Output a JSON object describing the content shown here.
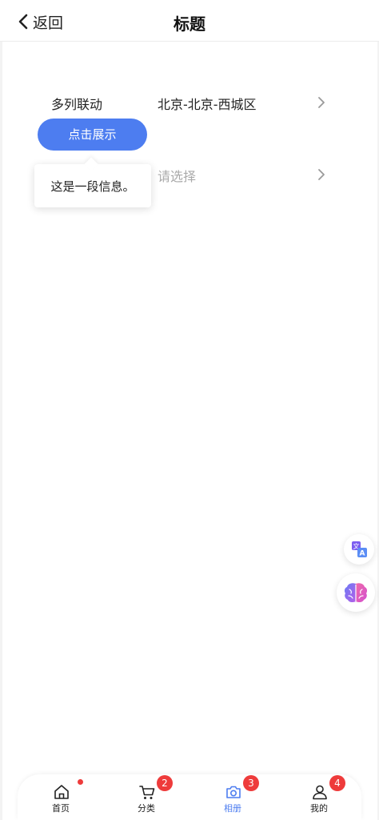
{
  "header": {
    "back_label": "返回",
    "title": "标题"
  },
  "rows": [
    {
      "label": "多列联动",
      "value": "北京-北京-西城区"
    },
    {
      "label": "",
      "placeholder": "请选择"
    }
  ],
  "show_button_label": "点击展示",
  "popup_text": "这是一段信息。",
  "tabbar": {
    "tabs": [
      {
        "label": "首页",
        "icon": "home-icon",
        "badge": ""
      },
      {
        "label": "分类",
        "icon": "cart-icon",
        "badge": "2"
      },
      {
        "label": "相册",
        "icon": "camera-icon",
        "badge": "3",
        "active": true
      },
      {
        "label": "我的",
        "icon": "user-icon",
        "badge": "4"
      }
    ]
  },
  "colors": {
    "accent": "#4d7df0",
    "badge": "#ee3b3b",
    "placeholder": "#aaaaaa"
  }
}
